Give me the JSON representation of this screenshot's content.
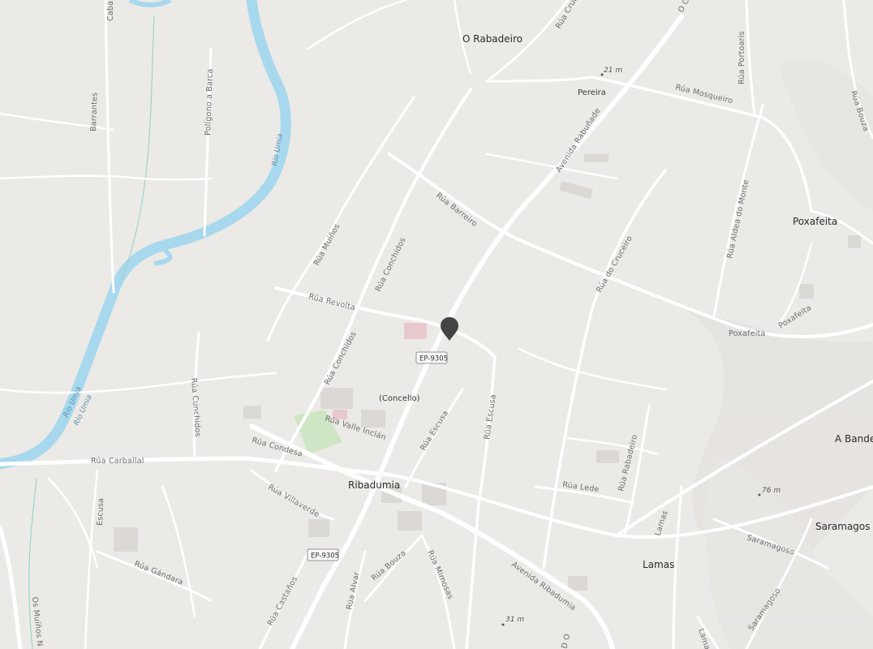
{
  "places": {
    "o_rabadeiro": "O Rabadeiro",
    "poxafeita": "Poxafeita",
    "ribadumia": "Ribadumia",
    "lamas": "Lamas",
    "saramagos": "Saramagos",
    "a_bande": "A Bande",
    "pereira": "Pereira",
    "concello": "(Concello)"
  },
  "streets": {
    "rua_mosqueiro": "Rúa Mosqueiro",
    "rua_portoaris": "Rúa Portoaris",
    "avenida_rabunade": "Avenida Rabuñade",
    "rua_barreiro": "Rúa Barreiro",
    "rua_do_cruceiro": "Rúa do Cruceiro",
    "rua_aldea_do_monte": "Rúa Aldea do Monte",
    "poxafeita_road": "Poxafeita",
    "poxafeita_road2": "Poxafeita",
    "rua_muinos": "Rúa Muíños",
    "rua_conchidos": "Rúa Conchidos",
    "rua_conchidos2": "Rúa Conchidos",
    "rua_revolta": "Rúa Revolta",
    "rua_cunchidos": "Rúa Cunchidos",
    "rua_valle_inclan": "Rúa Valle Inclán",
    "rua_condesa": "Rúa Condesa",
    "rua_carballal": "Rúa Carballal",
    "rua_escusa": "Rúa Escusa",
    "rua_escusa2": "Rúa Escusa",
    "rua_rabadeiro": "Rúa Rabadeiro",
    "rua_lede": "Rúa Lede",
    "rua_villaverde": "Rúa Villaverde",
    "escusa": "Escusa",
    "rua_gandara": "Rúa Gándara",
    "rua_castanos": "Rúa Castaños",
    "rua_alvar": "Rúa Alvar",
    "rua_bouza": "Rúa Bouza",
    "rua_mimosas": "Rúa Mimosas",
    "avenida_ribadumia": "Avenida Ribadumia",
    "saramagoso": "Saramagoso",
    "saramagoso2": "Saramagoso",
    "lamas_road": "Lamas",
    "lamas_road2": "Lamas",
    "barrantes": "Barrantes",
    "poligono_a_barca": "Polígono a Barca",
    "os_muinos": "Os Muíños N",
    "rua_bouza_ne": "Rúa Bouza",
    "rua_cruce": "Rúa Cruce",
    "cabana": "Cabar",
    "o_c": "O C",
    "d_o": "D O"
  },
  "river": {
    "name": "Río Umia",
    "name2": "Río Umia",
    "name3": "Río Umia"
  },
  "shields": {
    "ep1": "EP-9305",
    "ep2": "EP-9305"
  },
  "elevations": {
    "e21": "21 m",
    "e76": "76 m",
    "e31": "31 m"
  },
  "colors": {
    "land": "#eceae6",
    "road": "#ffffff",
    "water": "#a8d8ee",
    "marker": "#444444",
    "building_pink": "#e7c9cd",
    "park_green": "#cfe6c5"
  },
  "marker": {
    "icon": "map-pin-icon"
  }
}
